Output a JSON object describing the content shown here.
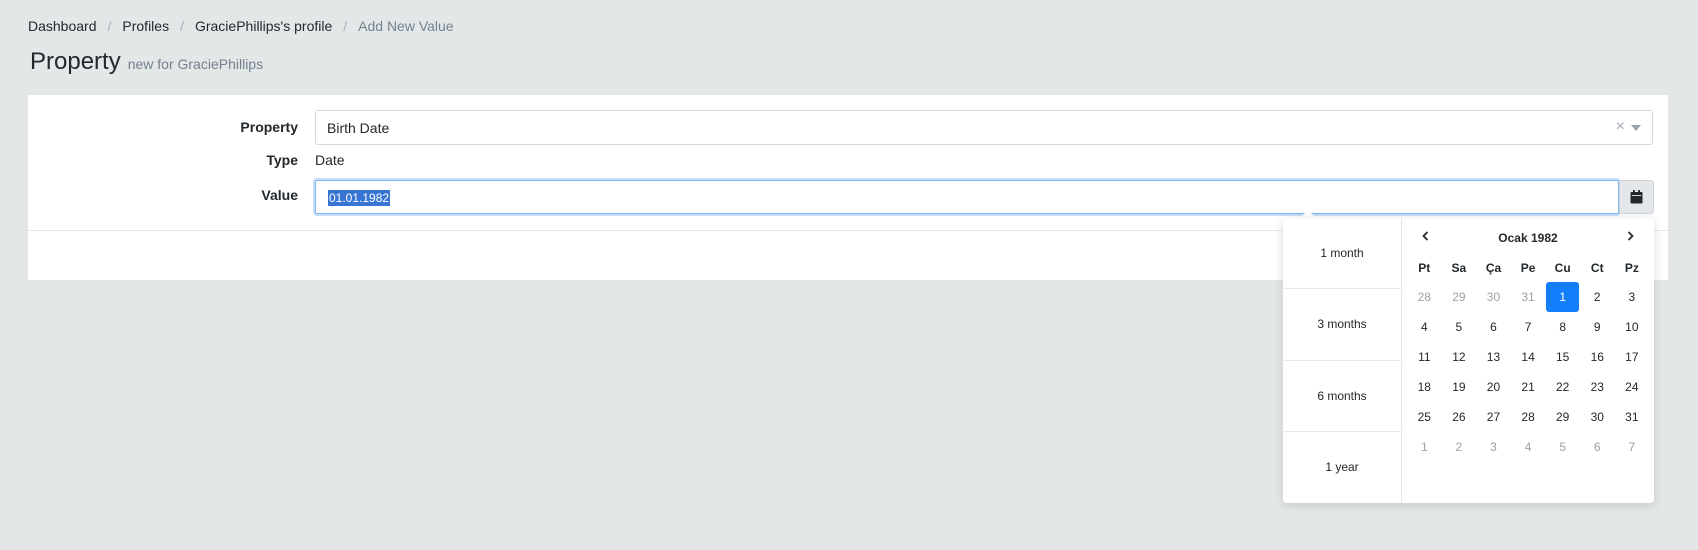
{
  "breadcrumb": [
    "Dashboard",
    "Profiles",
    "GraciePhillips's profile",
    "Add New Value"
  ],
  "page": {
    "title": "Property",
    "subtitle": "new for GraciePhillips"
  },
  "form": {
    "property_label": "Property",
    "property_value": "Birth Date",
    "clear_symbol": "×",
    "type_label": "Type",
    "type_value": "Date",
    "value_label": "Value",
    "value_input": "01.01.1982"
  },
  "datepicker": {
    "ranges": [
      "1 month",
      "3 months",
      "6 months",
      "1 year"
    ],
    "month_title": "Ocak 1982",
    "weekdays": [
      "Pt",
      "Sa",
      "Ça",
      "Pe",
      "Cu",
      "Ct",
      "Pz"
    ],
    "days": [
      [
        "28",
        "29",
        "30",
        "31",
        "1",
        "2",
        "3"
      ],
      [
        "4",
        "5",
        "6",
        "7",
        "8",
        "9",
        "10"
      ],
      [
        "11",
        "12",
        "13",
        "14",
        "15",
        "16",
        "17"
      ],
      [
        "18",
        "19",
        "20",
        "21",
        "22",
        "23",
        "24"
      ],
      [
        "25",
        "26",
        "27",
        "28",
        "29",
        "30",
        "31"
      ],
      [
        "1",
        "2",
        "3",
        "4",
        "5",
        "6",
        "7"
      ]
    ],
    "muted": [
      [
        0,
        0
      ],
      [
        0,
        1
      ],
      [
        0,
        2
      ],
      [
        0,
        3
      ],
      [
        5,
        0
      ],
      [
        5,
        1
      ],
      [
        5,
        2
      ],
      [
        5,
        3
      ],
      [
        5,
        4
      ],
      [
        5,
        5
      ],
      [
        5,
        6
      ]
    ],
    "selected": [
      0,
      4
    ],
    "accent_color": "#137ef9"
  },
  "icons": {
    "calendar": "calendar-icon",
    "prev": "chevron-left-icon",
    "next": "chevron-right-icon"
  }
}
